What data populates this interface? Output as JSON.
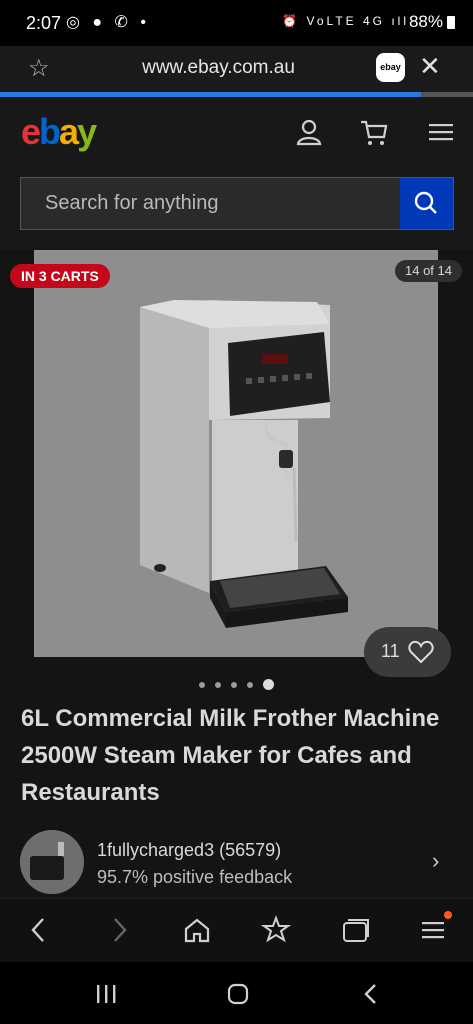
{
  "status_bar": {
    "time": "2:07",
    "notification_icons": [
      "at-icon",
      "chat-icon",
      "missed-call-icon",
      "dot"
    ],
    "right_icons": [
      "alarm-icon",
      "volte-icon",
      "4g-icon",
      "signal-icon"
    ],
    "battery": "88%"
  },
  "browser": {
    "url": "www.ebay.com.au",
    "tab_site_label": "ebay",
    "load_progress": 0.89
  },
  "header": {
    "logo": {
      "e": "e",
      "b": "b",
      "a": "a",
      "y": "y"
    },
    "search_placeholder": "Search for anything"
  },
  "listing": {
    "carts_badge": "IN 3 CARTS",
    "image_counter": "14 of 14",
    "watch_count": "11",
    "carousel_dots": 5,
    "active_dot": 4,
    "title": "6L Commercial Milk Frother Machine 2500W Steam Maker for Cafes and Restaurants",
    "seller": {
      "name": "1fullycharged3 (56579)",
      "feedback": "95.7% positive feedback"
    }
  },
  "colors": {
    "accent_blue": "#0038b8",
    "badge_red": "#c3081c",
    "progress_blue": "#2b79e0"
  }
}
